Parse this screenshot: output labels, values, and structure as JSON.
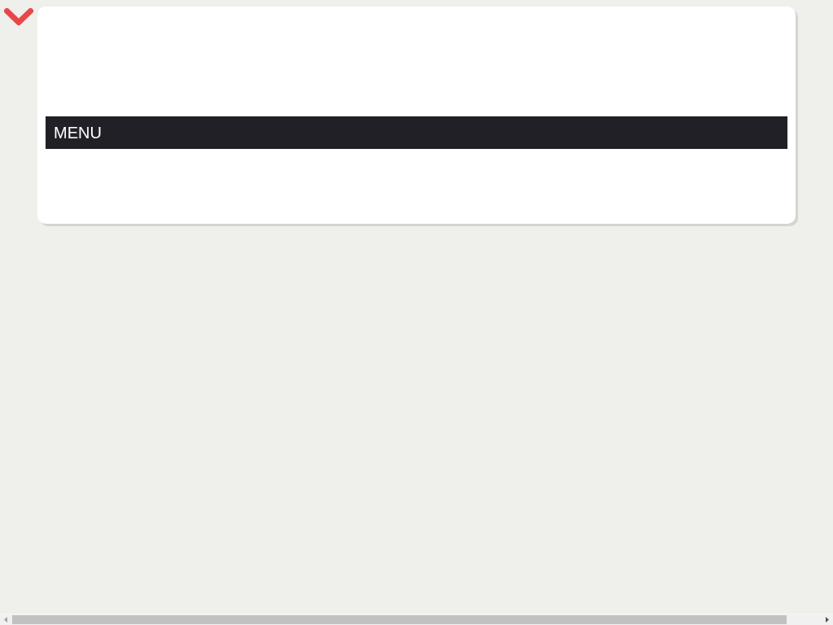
{
  "menu_bar": {
    "label": "MENU"
  }
}
